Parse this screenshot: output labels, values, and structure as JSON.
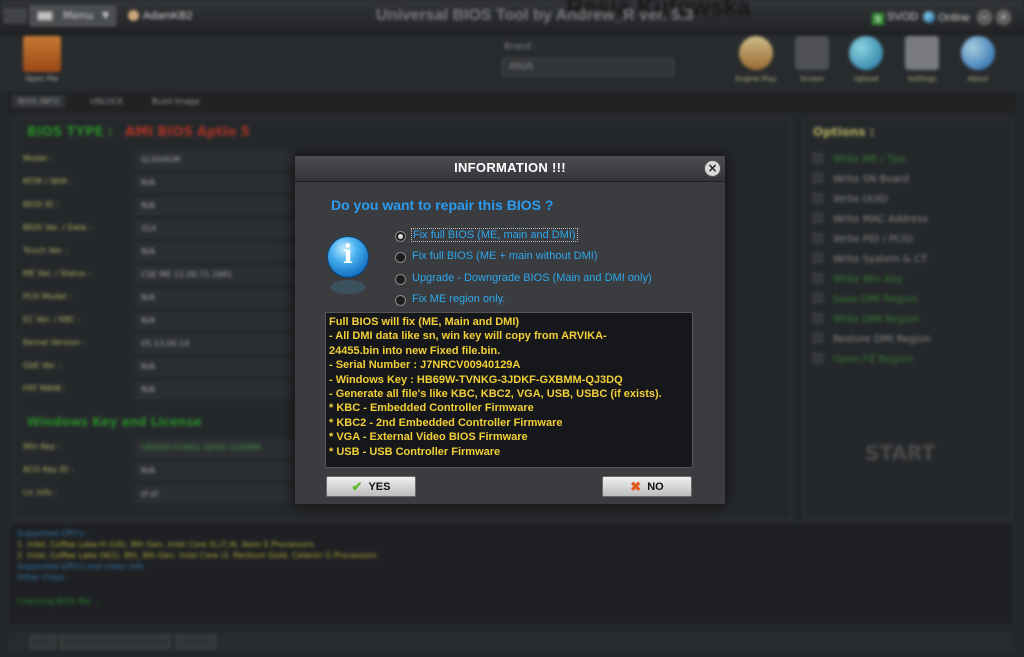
{
  "titlebar": {
    "menu": "Menu",
    "user": "AdamKB2",
    "title": "Universal BIOS Tool by Andrew_R ver. 5.3",
    "ghost_text": "Resia Kutowska",
    "svod": "SVOD",
    "online": "Online"
  },
  "toolbar": {
    "open_file": "Open File",
    "brand_label": "Brand :",
    "brand_value": "ASUS",
    "tools": [
      "Engine Play",
      "Screen",
      "Upload",
      "Settings",
      "About"
    ]
  },
  "subtabs": [
    "BIOS INFO",
    "UNLOCK",
    "Build Image"
  ],
  "left_panel": {
    "bios_type_label": "BIOS TYPE :",
    "bios_type_value": "AMI BIOS Aptio 5",
    "fields": [
      {
        "key": "Model :",
        "value": "GL504GM"
      },
      {
        "key": "MTM / SKM :",
        "value": "N/A"
      },
      {
        "key": "BIOS ID :",
        "value": "N/A"
      },
      {
        "key": "BIOS Ver. / Date :",
        "value": "314"
      },
      {
        "key": "Touch Ver. :",
        "value": "N/A"
      },
      {
        "key": "ME Ver. / Status :",
        "value": "CSE ME    12.00.71.1681"
      },
      {
        "key": "PCH Model :",
        "value": "N/A"
      },
      {
        "key": "EC Ver. / KBC :",
        "value": "N/A"
      },
      {
        "key": "Kernel Version :",
        "value": "05.13.00.14"
      },
      {
        "key": "GbE Ver. :",
        "value": "N/A"
      },
      {
        "key": "FRT MAIN :",
        "value": "N/A"
      }
    ],
    "win_title": "Windows Key and License",
    "win_fields": [
      {
        "key": "Win Key :",
        "value": "HB69W-TVNKG-3JDKF-GXBMM"
      },
      {
        "key": "ACO Key ID :",
        "value": "N/A"
      },
      {
        "key": "Lic Info :",
        "value": "pl-pl"
      }
    ]
  },
  "options": {
    "title": "Options :",
    "items": [
      "Write ME / Tpe",
      "Write SN Board",
      "Write UUID",
      "Write MAC Address",
      "Write PID / PCID",
      "Write System & CT",
      "Write Win Key",
      "Save DMI Region",
      "Write DMI Region",
      "Restore DMI Region",
      "Open FZ Region"
    ],
    "start": "START"
  },
  "log": {
    "lines": [
      "Supported CPU's :",
      "1. Intel, Coffee Lake-H (U4), 8th Gen. Intel Core i5,i7,i9, Xeon E Processors",
      "2. Intel, Coffee Lake (W2), 8th, 9th Gen. Intel Core i3, Pentium Gold, Celeron G Processors",
      "Supported GPU's and video info",
      "Other Chips :",
      "Checking BIOS file ..."
    ]
  },
  "dialog": {
    "title": "INFORMATION !!!",
    "question": "Do you want to repair this BIOS ?",
    "options": [
      {
        "label": "Fix full BIOS (ME, main and DMI)",
        "selected": true
      },
      {
        "label": "Fix full BIOS (ME + main without DMI)",
        "selected": false
      },
      {
        "label": "Upgrade - Downgrade BIOS (Main and DMI only)",
        "selected": false
      },
      {
        "label": "Fix ME region only.",
        "selected": false
      }
    ],
    "description": [
      "Full BIOS will fix (ME, Main and DMI)",
      "- All DMI data like sn, win key will copy from ARVIKA-",
      "24455.bin into new Fixed file.bin.",
      "- Serial Number : J7NRCV00940129A",
      "- Windows Key : HB69W-TVNKG-3JDKF-GXBMM-QJ3DQ",
      "- Generate all file's like KBC, KBC2, VGA, USB, USBC (if exists).",
      "* KBC - Embedded Controller Firmware",
      "* KBC2 - 2nd Embedded Controller Firmware",
      "* VGA - External Video BIOS Firmware",
      "* USB - USB Controller Firmware"
    ],
    "yes": "YES",
    "no": "NO"
  },
  "colors": {
    "accent_blue": "#2b9cf0",
    "description_text": "#f2d038",
    "green_label": "#2e9a2e",
    "red_value": "#c23b2b"
  },
  "icons": {
    "yes": "checkmark-icon",
    "no": "x-icon",
    "info": "info-icon"
  }
}
